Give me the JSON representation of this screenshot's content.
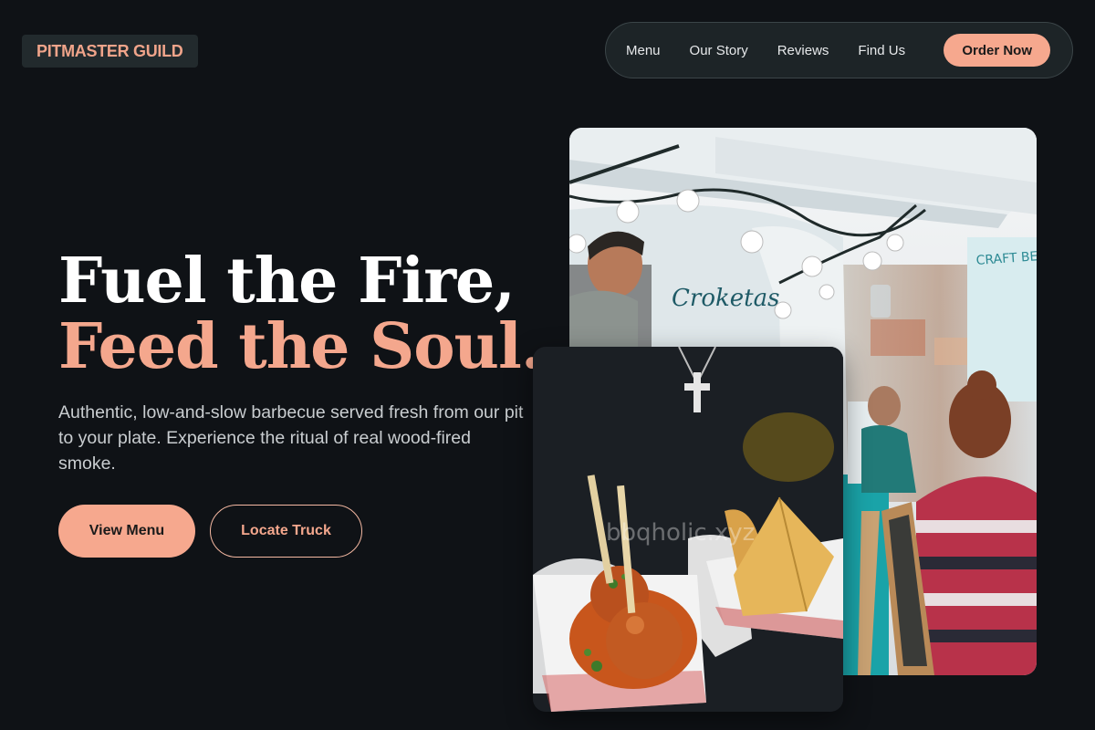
{
  "brand": {
    "name": "PITMASTER GUILD"
  },
  "nav": {
    "items": [
      {
        "label": "Menu"
      },
      {
        "label": "Our Story"
      },
      {
        "label": "Reviews"
      },
      {
        "label": "Find Us"
      }
    ],
    "cta_label": "Order Now"
  },
  "hero": {
    "headline_line1": "Fuel the Fire,",
    "headline_line2": "Feed the Soul.",
    "subtext": "Authentic, low-and-slow barbecue served fresh from our pit to your plate. Experience the ritual of real wood-fired smoke.",
    "primary_button": "View Menu",
    "secondary_button": "Locate Truck"
  },
  "images": {
    "back": {
      "sign_text": "Croketas",
      "side_sign": "CRAFT BEER & FOOD TRUCK"
    },
    "front": {
      "watermark": "bbqholic.xyz"
    }
  },
  "colors": {
    "background": "#0f1216",
    "accent": "#f6a88e",
    "brand_bg": "#222a2d"
  }
}
